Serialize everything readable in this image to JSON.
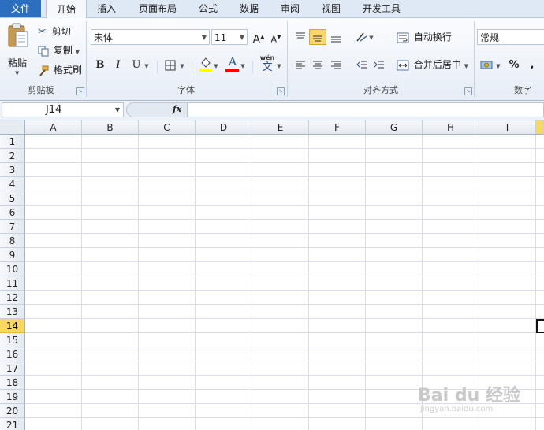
{
  "tabs": {
    "file": "文件",
    "items": [
      "开始",
      "插入",
      "页面布局",
      "公式",
      "数据",
      "审阅",
      "视图",
      "开发工具"
    ],
    "active": "开始"
  },
  "ribbon": {
    "clipboard": {
      "paste": "粘贴",
      "cut": "剪切",
      "copy": "复制",
      "format_painter": "格式刷",
      "label": "剪贴板"
    },
    "font": {
      "font_name": "宋体",
      "font_size": "11",
      "grow": "A",
      "shrink": "A",
      "bold": "B",
      "italic": "I",
      "underline": "U",
      "font_color_glyph": "A",
      "phonetic": "wén",
      "phonetic_char": "文",
      "label": "字体"
    },
    "alignment": {
      "wrap_text": "自动换行",
      "merge_center": "合并后居中",
      "label": "对齐方式"
    },
    "number": {
      "format": "常规",
      "percent": "%",
      "comma": ",",
      "label": "数字"
    }
  },
  "formula_bar": {
    "name_box": "J14",
    "fx": "fx",
    "formula": ""
  },
  "sheet": {
    "columns": [
      "A",
      "B",
      "C",
      "D",
      "E",
      "F",
      "G",
      "H",
      "I"
    ],
    "rows": [
      "1",
      "2",
      "3",
      "4",
      "5",
      "6",
      "7",
      "8",
      "9",
      "10",
      "11",
      "12",
      "13",
      "14",
      "15",
      "16",
      "17",
      "18",
      "19",
      "20",
      "21"
    ],
    "selected_row": "14",
    "selected_cell": "J14"
  },
  "watermark": {
    "brand": "Bai du 经验",
    "url": "jingyan.baidu.com"
  },
  "colors": {
    "file_tab": "#2c6fbf",
    "selection_highlight": "#f9d862",
    "fill_color": "#ffff00",
    "font_color": "#ff0000"
  }
}
